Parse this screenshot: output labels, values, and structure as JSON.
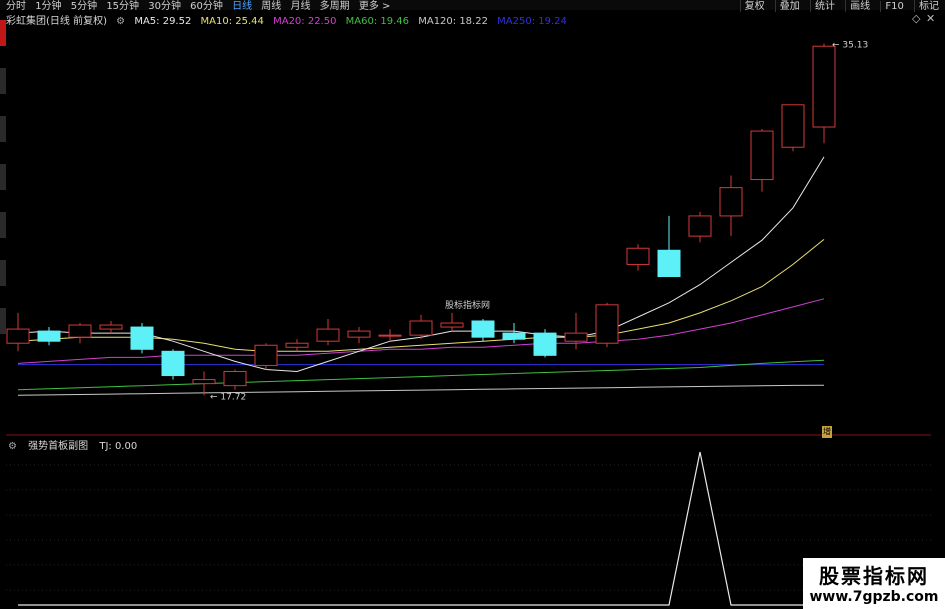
{
  "topbar": {
    "period_tabs": [
      "分时",
      "1分钟",
      "5分钟",
      "15分钟",
      "30分钟",
      "60分钟",
      "日线",
      "周线",
      "月线",
      "多周期",
      "更多 >"
    ],
    "active_tab": "日线",
    "right_buttons": [
      "复权",
      "叠加",
      "统计",
      "画线",
      "F10",
      "标记"
    ]
  },
  "legend": {
    "stock": "彩虹集团(日线 前复权)",
    "ma5": "MA5: 29.52",
    "ma10": "MA10: 25.44",
    "ma20": "MA20: 22.50",
    "ma60": "MA60: 19.46",
    "ma120": "MA120: 18.22",
    "ma250": "MA250: 19.24"
  },
  "price_panel": {
    "high_label": "35.13",
    "low_label": "17.72",
    "center_watermark": "股标指标网",
    "badge": "增"
  },
  "sub_panel": {
    "title": "强势首板副图",
    "value": "TJ: 0.00"
  },
  "watermark": {
    "line1": "股票指标网",
    "line2": "www.7gpzb.com"
  },
  "colors": {
    "up": "#d23a3a",
    "down": "#5ef0f7",
    "ma5": "#e8e8e8",
    "ma10": "#e8e070",
    "ma20": "#d040d0",
    "ma60": "#40c040",
    "ma120": "#c8c8c8",
    "ma250": "#3030e0"
  },
  "chart_data": {
    "type": "candlestick",
    "price_range": [
      16.5,
      36.0
    ],
    "candles": [
      {
        "o": 20.3,
        "c": 21.0,
        "h": 21.8,
        "l": 19.9
      },
      {
        "o": 20.9,
        "c": 20.4,
        "h": 21.1,
        "l": 20.2
      },
      {
        "o": 20.6,
        "c": 21.2,
        "h": 21.3,
        "l": 20.3
      },
      {
        "o": 21.0,
        "c": 21.2,
        "h": 21.4,
        "l": 20.8
      },
      {
        "o": 21.1,
        "c": 20.0,
        "h": 21.3,
        "l": 19.8
      },
      {
        "o": 19.9,
        "c": 18.7,
        "h": 20.0,
        "l": 18.5
      },
      {
        "o": 18.3,
        "c": 18.5,
        "h": 18.9,
        "l": 17.72
      },
      {
        "o": 18.2,
        "c": 18.9,
        "h": 19.0,
        "l": 18.0
      },
      {
        "o": 19.2,
        "c": 20.2,
        "h": 20.3,
        "l": 19.0
      },
      {
        "o": 20.1,
        "c": 20.3,
        "h": 20.5,
        "l": 19.9
      },
      {
        "o": 20.4,
        "c": 21.0,
        "h": 21.5,
        "l": 20.2
      },
      {
        "o": 20.6,
        "c": 20.9,
        "h": 21.1,
        "l": 20.3
      },
      {
        "o": 20.7,
        "c": 20.7,
        "h": 21.0,
        "l": 20.4
      },
      {
        "o": 20.7,
        "c": 21.4,
        "h": 21.7,
        "l": 20.5
      },
      {
        "o": 21.1,
        "c": 21.3,
        "h": 21.8,
        "l": 20.9
      },
      {
        "o": 21.4,
        "c": 20.6,
        "h": 21.5,
        "l": 20.4
      },
      {
        "o": 20.8,
        "c": 20.5,
        "h": 21.3,
        "l": 20.3
      },
      {
        "o": 20.8,
        "c": 19.7,
        "h": 21.0,
        "l": 19.6
      },
      {
        "o": 20.4,
        "c": 20.8,
        "h": 21.8,
        "l": 20.0
      },
      {
        "o": 20.3,
        "c": 22.2,
        "h": 22.3,
        "l": 20.1
      },
      {
        "o": 24.2,
        "c": 25.0,
        "h": 25.2,
        "l": 23.9
      },
      {
        "o": 24.9,
        "c": 23.6,
        "h": 26.6,
        "l": 23.6
      },
      {
        "o": 25.6,
        "c": 26.6,
        "h": 26.8,
        "l": 25.3
      },
      {
        "o": 26.6,
        "c": 28.0,
        "h": 28.6,
        "l": 25.6
      },
      {
        "o": 28.4,
        "c": 30.8,
        "h": 30.9,
        "l": 27.8
      },
      {
        "o": 30.0,
        "c": 32.1,
        "h": 32.1,
        "l": 29.8
      },
      {
        "o": 31.0,
        "c": 35.0,
        "h": 35.13,
        "l": 30.2
      }
    ],
    "ma5": [
      20.8,
      20.9,
      20.8,
      20.8,
      20.8,
      20.4,
      19.9,
      19.4,
      19.0,
      18.9,
      19.4,
      19.9,
      20.4,
      20.6,
      20.9,
      20.9,
      20.9,
      20.7,
      20.6,
      20.9,
      21.6,
      22.3,
      23.2,
      24.3,
      25.4,
      27.0,
      29.52
    ],
    "ma10": [
      20.4,
      20.5,
      20.6,
      20.6,
      20.6,
      20.5,
      20.3,
      20.0,
      19.9,
      19.9,
      19.9,
      20.0,
      20.1,
      20.2,
      20.3,
      20.4,
      20.5,
      20.6,
      20.6,
      20.7,
      21.0,
      21.3,
      21.8,
      22.4,
      23.1,
      24.2,
      25.44
    ],
    "ma20": [
      19.3,
      19.4,
      19.5,
      19.6,
      19.6,
      19.7,
      19.7,
      19.7,
      19.7,
      19.7,
      19.8,
      19.9,
      20.0,
      20.0,
      20.1,
      20.1,
      20.2,
      20.3,
      20.3,
      20.4,
      20.5,
      20.7,
      21.0,
      21.3,
      21.7,
      22.1,
      22.5
    ],
    "ma60": [
      18.0,
      18.05,
      18.1,
      18.15,
      18.2,
      18.25,
      18.3,
      18.35,
      18.4,
      18.45,
      18.5,
      18.55,
      18.6,
      18.65,
      18.7,
      18.75,
      18.8,
      18.85,
      18.9,
      18.95,
      19.0,
      19.05,
      19.1,
      19.2,
      19.3,
      19.38,
      19.46
    ],
    "ma120": [
      17.72,
      17.74,
      17.76,
      17.78,
      17.8,
      17.82,
      17.84,
      17.86,
      17.88,
      17.9,
      17.92,
      17.94,
      17.96,
      17.98,
      18.0,
      18.02,
      18.04,
      18.06,
      18.08,
      18.1,
      18.12,
      18.14,
      18.16,
      18.18,
      18.2,
      18.21,
      18.22
    ],
    "ma250": [
      19.24,
      19.24,
      19.24,
      19.24,
      19.24,
      19.24,
      19.24,
      19.24,
      19.24,
      19.24,
      19.24,
      19.24,
      19.24,
      19.24,
      19.24,
      19.24,
      19.24,
      19.24,
      19.24,
      19.24,
      19.24,
      19.24,
      19.24,
      19.24,
      19.24,
      19.24,
      19.24
    ],
    "tj": [
      0,
      0,
      0,
      0,
      0,
      0,
      0,
      0,
      0,
      0,
      0,
      0,
      0,
      0,
      0,
      0,
      0,
      0,
      0,
      0,
      0,
      0,
      1,
      0,
      0,
      0,
      0
    ]
  }
}
